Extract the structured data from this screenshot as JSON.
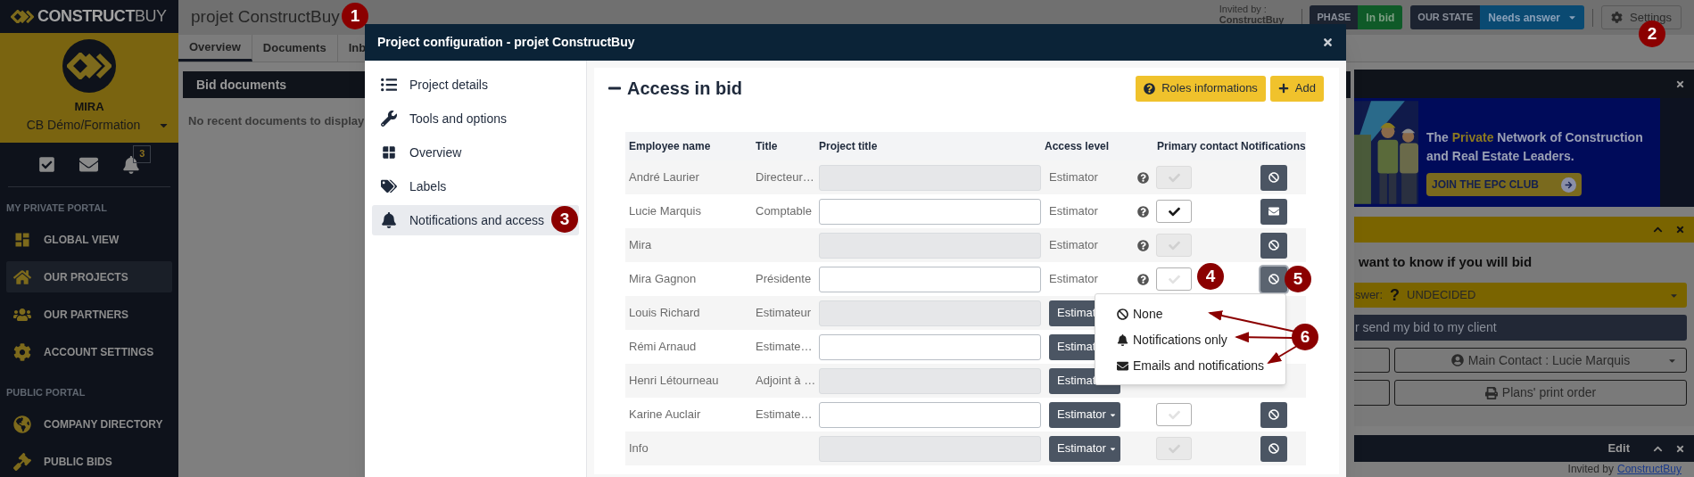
{
  "sidebar": {
    "logo": "**CONSTRUCT**BUY",
    "profile": {
      "name": "MIRA",
      "company": "CB Démo/Formation"
    },
    "notification_badge": "3",
    "sections": [
      {
        "title": "MY PRIVATE PORTAL",
        "items": [
          {
            "label": "GLOBAL VIEW",
            "selected": false
          },
          {
            "label": "OUR PROJECTS",
            "selected": true
          },
          {
            "label": "OUR PARTNERS",
            "selected": false
          },
          {
            "label": "ACCOUNT SETTINGS",
            "selected": false
          }
        ]
      },
      {
        "title": "PUBLIC PORTAL",
        "items": [
          {
            "label": "COMPANY DIRECTORY",
            "selected": false
          },
          {
            "label": "PUBLIC BIDS",
            "selected": false
          }
        ]
      }
    ]
  },
  "project": {
    "title": "projet ConstructBuy",
    "tabs": [
      {
        "label": "Overview",
        "selected": true
      },
      {
        "label": "Documents",
        "selected": false
      },
      {
        "label": "Inb",
        "selected": false
      }
    ],
    "bid_documents": {
      "title": "Bid documents",
      "empty_text": "No recent documents to display"
    }
  },
  "header": {
    "invited_by_label": "Invited by :",
    "invited_by": "ConstructBuy",
    "phase_label": "PHASE",
    "phase": "In bid",
    "state_label": "OUR STATE",
    "state": "Needs answer",
    "settings": "Settings"
  },
  "right_panel": {
    "banner": {
      "headline": "The **Private** Network of Construction and Real Estate Leaders.",
      "button": "JOIN THE EPC CLUB"
    },
    "bid_card": {
      "question": "want to know if you will bid",
      "answer_label": "swer:",
      "answer_icon": "?",
      "answer": "UNDECIDED",
      "send_button": "r send my bid to my client",
      "main_contact": "Main Contact : Lucie Marquis",
      "print_order": "Plans' print order"
    },
    "edit_bar": {
      "label": "Edit"
    },
    "footer": {
      "invited_by_label": "Invited by",
      "invited_by": "ConstructBuy"
    }
  },
  "modal": {
    "title": "Project configuration - projet ConstructBuy",
    "menu": [
      {
        "label": "Project details",
        "selected": false
      },
      {
        "label": "Tools and options",
        "selected": false
      },
      {
        "label": "Overview",
        "selected": false
      },
      {
        "label": "Labels",
        "selected": false
      },
      {
        "label": "Notifications and access",
        "selected": true
      }
    ],
    "section": {
      "title": "Access in bid",
      "buttons": [
        "Roles informations",
        "Add"
      ]
    },
    "table": {
      "columns": [
        "Employee name",
        "Title",
        "Project title",
        "Access level",
        "Primary contact",
        "Notifications"
      ],
      "rows": [
        {
          "name": "André Laurier",
          "title": "Directeur…",
          "project_title": {
            "disabled": true
          },
          "access": {
            "kind": "text",
            "label": "Estimator"
          },
          "primary_contact": {
            "checked": false,
            "disabled": true
          },
          "notifications": {
            "kind": "none",
            "open": false
          }
        },
        {
          "name": "Lucie Marquis",
          "title": "Comptable",
          "project_title": {
            "disabled": false
          },
          "access": {
            "kind": "text",
            "label": "Estimator"
          },
          "primary_contact": {
            "checked": true,
            "disabled": false
          },
          "notifications": {
            "kind": "email",
            "open": false
          }
        },
        {
          "name": "Mira",
          "project_title": {
            "disabled": true
          },
          "access": {
            "kind": "text",
            "label": "Estimator"
          },
          "primary_contact": {
            "checked": false,
            "disabled": true
          },
          "notifications": {
            "kind": "none",
            "open": false
          }
        },
        {
          "name": "Mira Gagnon",
          "title": "Présidente",
          "project_title": {
            "disabled": false
          },
          "access": {
            "kind": "text",
            "label": "Estimator"
          },
          "primary_contact": {
            "checked": false,
            "disabled": false
          },
          "notifications": {
            "kind": "none",
            "open": true
          }
        },
        {
          "name": "Louis Richard",
          "title": "Estimateur",
          "project_title": {
            "disabled": true
          },
          "access": {
            "kind": "dropdown",
            "label": "Estimat"
          }
        },
        {
          "name": "Rémi Arnaud",
          "title": "Estimate…",
          "project_title": {
            "disabled": false
          },
          "access": {
            "kind": "dropdown",
            "label": "Estimat"
          }
        },
        {
          "name": "Henri Létourneau",
          "title": "Adjoint à …",
          "project_title": {
            "disabled": true
          },
          "access": {
            "kind": "dropdown",
            "label": "Estimat"
          }
        },
        {
          "name": "Karine Auclair",
          "title": "Estimate…",
          "project_title": {
            "disabled": false
          },
          "access": {
            "kind": "dropdown",
            "label": "Estimator"
          },
          "primary_contact": {
            "checked": false,
            "disabled": false
          },
          "notifications": {
            "kind": "none",
            "open": false
          }
        },
        {
          "name": "Info",
          "project_title": {
            "disabled": true
          },
          "access": {
            "kind": "dropdown",
            "label": "Estimator"
          },
          "primary_contact": {
            "checked": false,
            "disabled": true
          },
          "notifications": {
            "kind": "none",
            "open": false
          }
        }
      ]
    },
    "notification_menu": [
      "None",
      "Notifications only",
      "Emails and notifications"
    ]
  },
  "annotations": [
    "1",
    "2",
    "3",
    "4",
    "5",
    "6"
  ]
}
